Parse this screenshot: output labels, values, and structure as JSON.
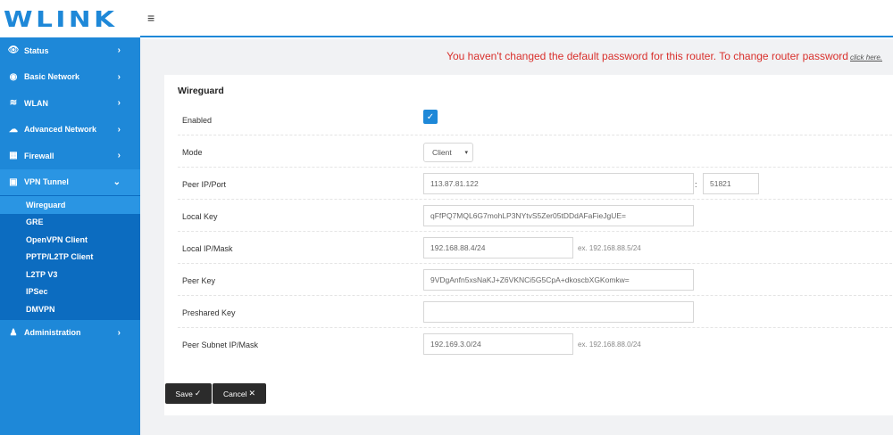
{
  "brand": {
    "logo": "WLINK"
  },
  "topbar": {
    "menu_icon": "≡"
  },
  "sidebar": {
    "items": [
      {
        "label": "Status",
        "icon": "eye-icon"
      },
      {
        "label": "Basic Network",
        "icon": "globe-icon"
      },
      {
        "label": "WLAN",
        "icon": "wifi-icon"
      },
      {
        "label": "Advanced Network",
        "icon": "cloud-icon"
      },
      {
        "label": "Firewall",
        "icon": "firewall-icon"
      },
      {
        "label": "VPN Tunnel",
        "icon": "vpn-icon"
      },
      {
        "label": "Administration",
        "icon": "user-icon"
      }
    ],
    "vpn_sub": [
      "Wireguard",
      "GRE",
      "OpenVPN Client",
      "PPTP/L2TP Client",
      "L2TP V3",
      "IPSec",
      "DMVPN"
    ],
    "active_sub": "Wireguard",
    "accent": "#1e88d8"
  },
  "warning": {
    "text": "You haven't changed the default password for this router. To change router password",
    "link": "click here.",
    "color": "#d9302c"
  },
  "form": {
    "title": "Wireguard",
    "enabled_label": "Enabled",
    "enabled": true,
    "mode_label": "Mode",
    "mode_value": "Client",
    "peer_ip_label": "Peer IP/Port",
    "peer_ip": "113.87.81.122",
    "port_sep": ":",
    "peer_port": "51821",
    "local_key_label": "Local Key",
    "local_key": "qFfPQ7MQL6G7mohLP3NYtvS5Zer05tDDdAFaFieJgUE=",
    "local_ip_label": "Local IP/Mask",
    "local_ip": "192.168.88.4/24",
    "local_ip_hint": "ex. 192.168.88.5/24",
    "peer_key_label": "Peer Key",
    "peer_key": "9VDgAnfn5xsNaKJ+Z6VKNCi5G5CpA+dkoscbXGKomkw=",
    "preshared_label": "Preshared Key",
    "preshared": "",
    "peer_subnet_label": "Peer Subnet IP/Mask",
    "peer_subnet": "192.169.3.0/24",
    "peer_subnet_hint": "ex. 192.168.88.0/24"
  },
  "buttons": {
    "save": "Save",
    "cancel": "Cancel"
  }
}
